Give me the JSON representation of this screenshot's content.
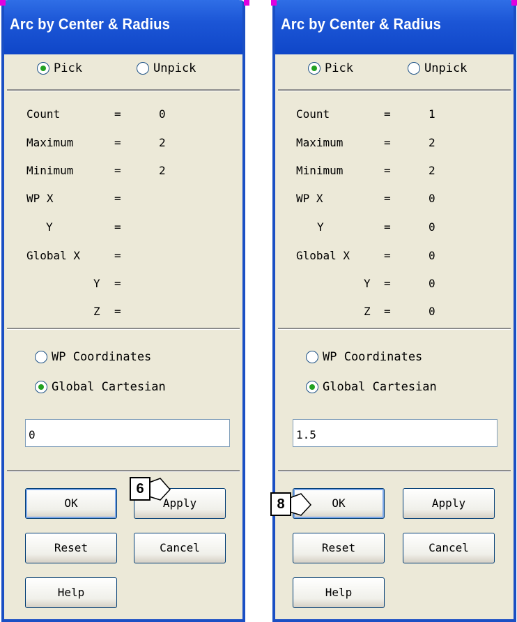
{
  "panels": [
    {
      "title": "Arc by Center & Radius",
      "pick_label": "Pick",
      "unpick_label": "Unpick",
      "info": [
        {
          "label": "Count",
          "eq": "=",
          "value": "0"
        },
        {
          "label": "Maximum",
          "eq": "=",
          "value": "2"
        },
        {
          "label": "Minimum",
          "eq": "=",
          "value": "2"
        },
        {
          "label": "WP X",
          "eq": "=",
          "value": ""
        },
        {
          "label": "Y",
          "eq": "=",
          "value": ""
        },
        {
          "label": "Global X",
          "eq": "=",
          "value": ""
        },
        {
          "label": "Y",
          "eq": "=",
          "value": ""
        },
        {
          "label": "Z",
          "eq": "=",
          "value": ""
        }
      ],
      "wp_coordinates_label": "WP Coordinates",
      "global_cartesian_label": "Global Cartesian",
      "input_value": "0",
      "ok_label": "OK",
      "apply_label": "Apply",
      "reset_label": "Reset",
      "cancel_label": "Cancel",
      "help_label": "Help",
      "callout": "6"
    },
    {
      "title": "Arc by Center & Radius",
      "pick_label": "Pick",
      "unpick_label": "Unpick",
      "info": [
        {
          "label": "Count",
          "eq": "=",
          "value": "1"
        },
        {
          "label": "Maximum",
          "eq": "=",
          "value": "2"
        },
        {
          "label": "Minimum",
          "eq": "=",
          "value": "2"
        },
        {
          "label": "WP X",
          "eq": "=",
          "value": "0"
        },
        {
          "label": "Y",
          "eq": "=",
          "value": "0"
        },
        {
          "label": "Global X",
          "eq": "=",
          "value": "0"
        },
        {
          "label": "Y",
          "eq": "=",
          "value": "0"
        },
        {
          "label": "Z",
          "eq": "=",
          "value": "0"
        }
      ],
      "wp_coordinates_label": "WP Coordinates",
      "global_cartesian_label": "Global Cartesian",
      "input_value": "1.5",
      "ok_label": "OK",
      "apply_label": "Apply",
      "reset_label": "Reset",
      "cancel_label": "Cancel",
      "help_label": "Help",
      "callout": "8"
    }
  ],
  "colors": {
    "titlebar": "#1c56d6",
    "panel_bg": "#ece9d8",
    "window_border": "#1a4fc4",
    "radio_dot": "#21a121"
  }
}
